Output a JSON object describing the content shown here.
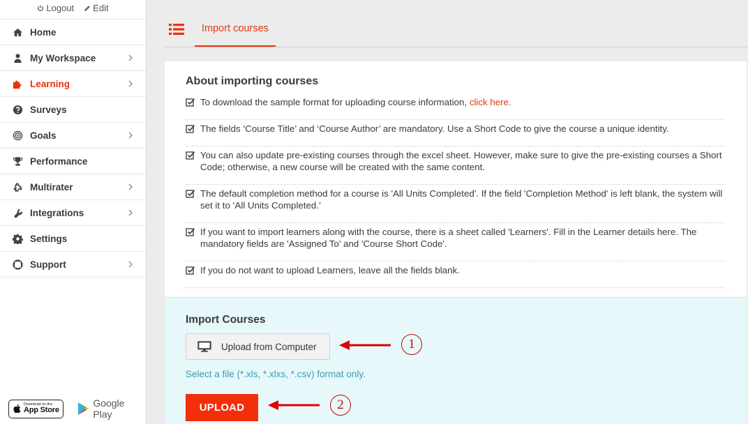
{
  "top_links": {
    "logout": "Logout",
    "edit": "Edit"
  },
  "sidebar": {
    "items": [
      {
        "label": "Home",
        "icon": "home-icon",
        "chevron": false,
        "active": false
      },
      {
        "label": "My Workspace",
        "icon": "user-icon",
        "chevron": true,
        "active": false
      },
      {
        "label": "Learning",
        "icon": "puzzle-icon",
        "chevron": true,
        "active": true
      },
      {
        "label": "Surveys",
        "icon": "question-icon",
        "chevron": false,
        "active": false
      },
      {
        "label": "Goals",
        "icon": "target-icon",
        "chevron": true,
        "active": false
      },
      {
        "label": "Performance",
        "icon": "trophy-icon",
        "chevron": false,
        "active": false
      },
      {
        "label": "Multirater",
        "icon": "recycle-icon",
        "chevron": true,
        "active": false
      },
      {
        "label": "Integrations",
        "icon": "plug-icon",
        "chevron": true,
        "active": false
      },
      {
        "label": "Settings",
        "icon": "gear-icon",
        "chevron": false,
        "active": false
      },
      {
        "label": "Support",
        "icon": "lifebuoy-icon",
        "chevron": true,
        "active": false
      }
    ],
    "app_store": {
      "small": "Download on the",
      "big": "App Store"
    },
    "google_play": "Google Play"
  },
  "tabs": {
    "active": "Import courses"
  },
  "about": {
    "title": "About importing courses",
    "items": [
      {
        "text": "To download the sample format for uploading course information, ",
        "link": "click here."
      },
      {
        "text": "The fields ‘Course Title’ and ‘Course Author’ are mandatory. Use a Short Code to give the course a unique identity."
      },
      {
        "text": "You can also update pre-existing courses through the excel sheet. However, make sure to give the pre-existing courses a Short Code; otherwise, a new course will be created with the same content."
      },
      {
        "text": "The default completion method for a course is 'All Units Completed'. If the field 'Completion Method' is left blank, the system will set it to ‘All Units Completed.’"
      },
      {
        "text": "If you want to import learners along with the course, there is a sheet called 'Learners'. Fill in the Learner details here. The mandatory fields are 'Assigned To' and 'Course Short Code'."
      },
      {
        "text": "If you do not want to upload Learners, leave all the fields blank."
      }
    ]
  },
  "import": {
    "title": "Import Courses",
    "upload_from_computer": "Upload from Computer",
    "file_hint": "Select a file (*.xls, *.xlxs, *.csv) format only.",
    "upload_button": "UPLOAD"
  },
  "annotations": {
    "one": "1",
    "two": "2"
  },
  "colors": {
    "accent": "#e8340c",
    "upload_button": "#f22f0a",
    "hint": "#3d9cb2",
    "annotation": "#cc0000",
    "import_bg": "#e7f8fb"
  }
}
